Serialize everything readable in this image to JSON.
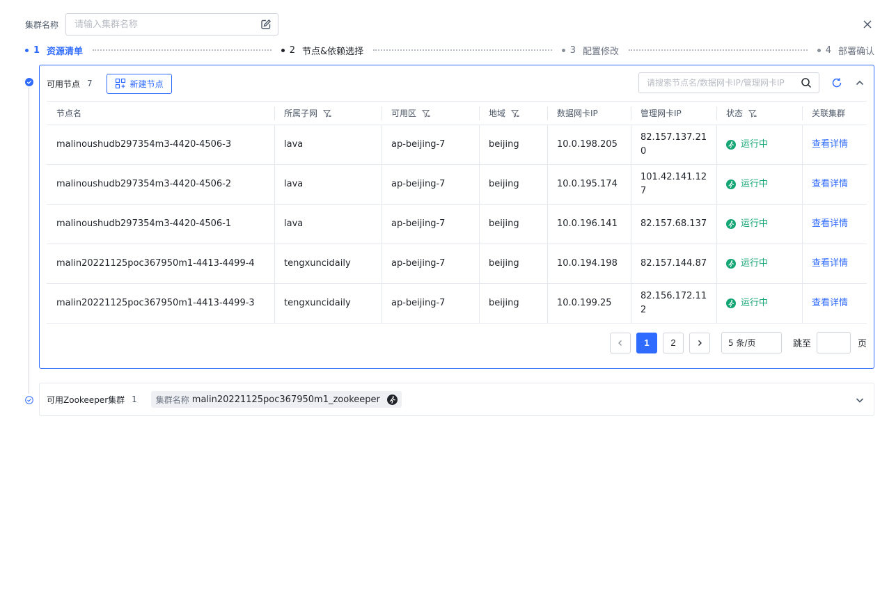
{
  "header": {
    "label": "集群名称",
    "placeholder": "请输入集群名称"
  },
  "steps": [
    {
      "num": "1",
      "label": "资源清单"
    },
    {
      "num": "2",
      "label": "节点&依赖选择"
    },
    {
      "num": "3",
      "label": "配置修改"
    },
    {
      "num": "4",
      "label": "部署确认"
    }
  ],
  "nodes": {
    "title": "可用节点",
    "count": "7",
    "new_button": "新建节点",
    "search_placeholder": "请搜索节点名/数据网卡IP/管理网卡IP",
    "columns": [
      "节点名",
      "所属子网",
      "可用区",
      "地域",
      "数据网卡IP",
      "管理网卡IP",
      "状态",
      "关联集群"
    ],
    "rows": [
      {
        "name": "malinoushudb297354m3-4420-4506-3",
        "subnet": "lava",
        "zone": "ap-beijing-7",
        "region": "beijing",
        "data_ip": "10.0.198.205",
        "mgmt_ip": "82.157.137.210",
        "status": "运行中",
        "link": "查看详情"
      },
      {
        "name": "malinoushudb297354m3-4420-4506-2",
        "subnet": "lava",
        "zone": "ap-beijing-7",
        "region": "beijing",
        "data_ip": "10.0.195.174",
        "mgmt_ip": "101.42.141.127",
        "status": "运行中",
        "link": "查看详情"
      },
      {
        "name": "malinoushudb297354m3-4420-4506-1",
        "subnet": "lava",
        "zone": "ap-beijing-7",
        "region": "beijing",
        "data_ip": "10.0.196.141",
        "mgmt_ip": "82.157.68.137",
        "status": "运行中",
        "link": "查看详情"
      },
      {
        "name": "malin20221125poc367950m1-4413-4499-4",
        "subnet": "tengxuncidaily",
        "zone": "ap-beijing-7",
        "region": "beijing",
        "data_ip": "10.0.194.198",
        "mgmt_ip": "82.157.144.87",
        "status": "运行中",
        "link": "查看详情"
      },
      {
        "name": "malin20221125poc367950m1-4413-4499-3",
        "subnet": "tengxuncidaily",
        "zone": "ap-beijing-7",
        "region": "beijing",
        "data_ip": "10.0.199.25",
        "mgmt_ip": "82.156.172.112",
        "status": "运行中",
        "link": "查看详情"
      }
    ],
    "pager": {
      "pages": [
        "1",
        "2"
      ],
      "page_size": "5 条/页",
      "jump_label": "跳至",
      "page_suffix": "页"
    }
  },
  "zookeeper": {
    "title": "可用Zookeeper集群",
    "count": "1",
    "tag_key": "集群名称",
    "tag_value": "malin20221125poc367950m1_zookeeper"
  },
  "colors": {
    "primary": "#2f6bff",
    "success": "#15a675",
    "border": "#e5e8ec"
  }
}
